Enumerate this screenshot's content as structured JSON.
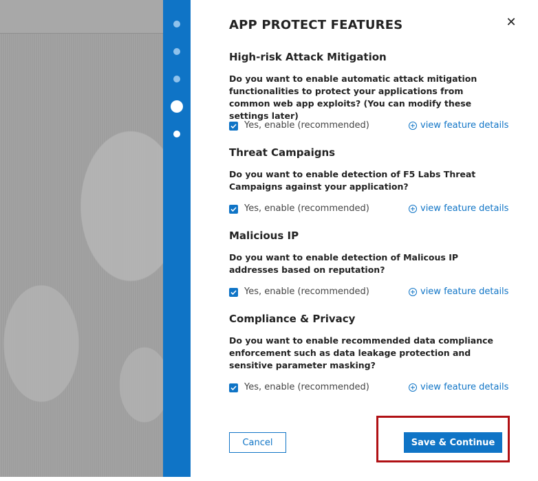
{
  "background": {
    "color": "#9e9e9e"
  },
  "rail": {
    "color": "#0f74c6",
    "steps": [
      "done",
      "done",
      "done",
      "active",
      "upcoming"
    ]
  },
  "panel": {
    "title": "APP PROTECT FEATURES",
    "close_icon": "close-icon",
    "sections": [
      {
        "title": "High-risk Attack Mitigation",
        "question": "Do you want to enable automatic attack mitigation functionalities to protect your applications from common web app exploits? (You can modify these settings later)",
        "checkbox_label": "Yes, enable (recommended)",
        "checked": true,
        "link": "view feature details"
      },
      {
        "title": "Threat Campaigns",
        "question": "Do you want to enable detection of F5 Labs Threat Campaigns against your application?",
        "checkbox_label": "Yes, enable (recommended)",
        "checked": true,
        "link": "view feature details"
      },
      {
        "title": "Malicious IP",
        "question": "Do you want to enable detection of Malicous IP addresses based on reputation?",
        "checkbox_label": "Yes, enable (recommended)",
        "checked": true,
        "link": "view feature details"
      },
      {
        "title": "Compliance & Privacy",
        "question": "Do you want to enable recommended data compliance enforcement such as data leakage protection and sensitive parameter masking?",
        "checkbox_label": "Yes, enable (recommended)",
        "checked": true,
        "link": "view feature details"
      }
    ],
    "cancel_label": "Cancel",
    "save_label": "Save & Continue"
  },
  "colors": {
    "accent": "#0f74c6",
    "highlight": "#b01014"
  }
}
